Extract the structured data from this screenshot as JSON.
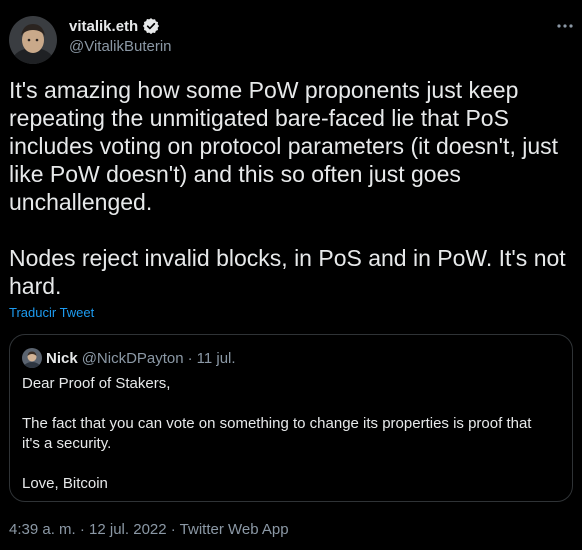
{
  "author": {
    "display_name": "vitalik.eth",
    "handle": "@VitalikButerin"
  },
  "tweet": {
    "paragraph_1": "It's amazing how some PoW proponents just keep repeating the unmitigated bare-faced lie that PoS includes voting on protocol parameters (it doesn't, just like PoW doesn't) and this so often just goes unchallenged.",
    "paragraph_2": "Nodes reject invalid blocks, in PoS and in PoW. It's not hard.",
    "translate_label": "Traducir Tweet"
  },
  "quoted_tweet": {
    "display_name": "Nick",
    "handle": "@NickDPayton",
    "separator": "·",
    "date": "11 jul.",
    "line_1": "Dear Proof of Stakers,",
    "line_2": "The fact that you can vote on something to change its properties is proof that it's a security.",
    "line_3": "Love, Bitcoin"
  },
  "footer": {
    "timestamp": "4:39 a. m. · 12 jul. 2022 · Twitter Web App"
  },
  "colors": {
    "background": "#000000",
    "text": "#e7e9ea",
    "secondary": "#8b98a5",
    "link": "#1d9bf0",
    "border": "#2f3336"
  },
  "icons": {
    "verified": "verified-badge-icon",
    "more": "more-dots-icon"
  }
}
